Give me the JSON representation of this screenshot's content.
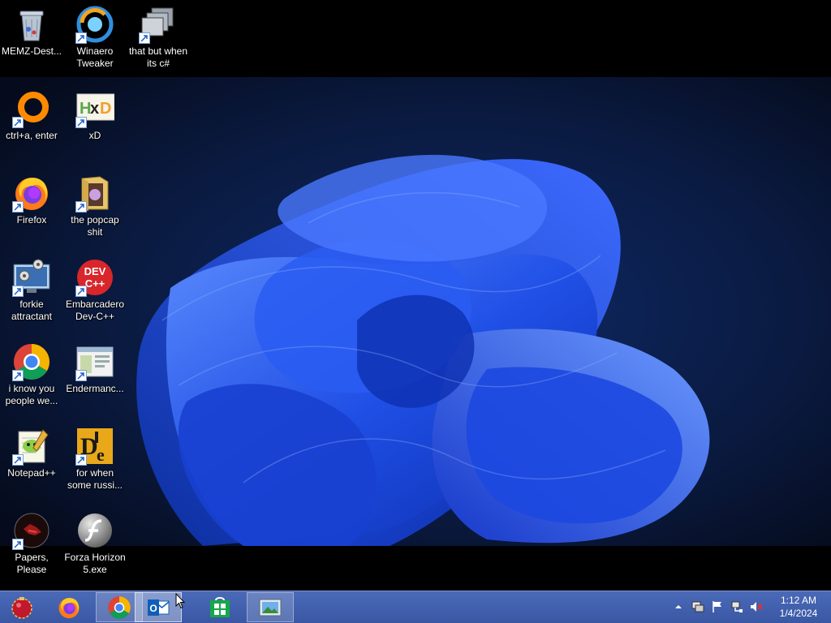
{
  "desktop_icons": [
    {
      "id": "memz",
      "label": "MEMZ-Dest...",
      "icon": "recycle-bin-icon",
      "shortcut": false
    },
    {
      "id": "winaero",
      "label": "Winaero Tweaker",
      "icon": "winaero-tweaker-icon",
      "shortcut": true
    },
    {
      "id": "csharp",
      "label": "that but when its c#",
      "icon": "window-stack-icon",
      "shortcut": true
    },
    {
      "id": "ctrl-a",
      "label": "ctrl+a, enter",
      "icon": "orange-ring-icon",
      "shortcut": true
    },
    {
      "id": "xd",
      "label": "xD",
      "icon": "hxd-icon",
      "shortcut": true
    },
    {
      "id": "firefox",
      "label": "Firefox",
      "icon": "firefox-icon",
      "shortcut": true
    },
    {
      "id": "popcap",
      "label": "the popcap shit",
      "icon": "folder-icon",
      "shortcut": true
    },
    {
      "id": "forkie",
      "label": "forkie attractant",
      "icon": "monitor-gears-icon",
      "shortcut": true
    },
    {
      "id": "devcpp",
      "label": "Embarcadero Dev-C++",
      "icon": "devcpp-icon",
      "shortcut": true
    },
    {
      "id": "chrome",
      "label": "i know you people we...",
      "icon": "chrome-icon",
      "shortcut": true
    },
    {
      "id": "enderman",
      "label": "Endermanc...",
      "icon": "window-app-icon",
      "shortcut": true
    },
    {
      "id": "notepadpp",
      "label": "Notepad++",
      "icon": "notepadpp-icon",
      "shortcut": true
    },
    {
      "id": "die",
      "label": "for when some russi...",
      "icon": "die-icon",
      "shortcut": true
    },
    {
      "id": "papers",
      "label": "Papers, Please",
      "icon": "papers-please-icon",
      "shortcut": true
    },
    {
      "id": "forza",
      "label": "Forza Horizon 5.exe",
      "icon": "flash-icon",
      "shortcut": true
    }
  ],
  "taskbar": {
    "start_icon": "start-orb-icon",
    "pinned": [
      {
        "name": "firefox",
        "icon": "firefox-icon",
        "state": "pinned"
      },
      {
        "name": "chrome",
        "icon": "chrome-icon",
        "state": "open"
      },
      {
        "name": "outlook",
        "icon": "outlook-icon",
        "state": "active"
      },
      {
        "name": "store",
        "icon": "store-icon",
        "state": "pinned"
      },
      {
        "name": "photos",
        "icon": "photo-viewer-icon",
        "state": "open"
      }
    ]
  },
  "tray": {
    "icons": [
      "show-hidden-icon",
      "display-icon",
      "flag-icon",
      "network-icon",
      "volume-muted-icon"
    ],
    "time": "1:12 AM",
    "date": "1/4/2024"
  }
}
